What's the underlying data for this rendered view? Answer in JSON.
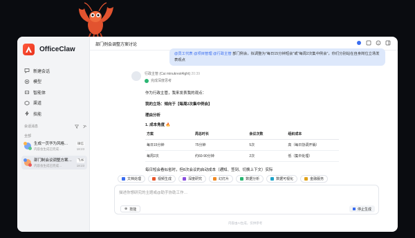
{
  "app": {
    "name": "OfficeClaw"
  },
  "nav": [
    {
      "label": "新建会话",
      "icon": "chat-plus-icon"
    },
    {
      "label": "模型",
      "icon": "model-icon"
    },
    {
      "label": "智能体",
      "icon": "agent-icon"
    },
    {
      "label": "渠道",
      "icon": "channel-icon"
    },
    {
      "label": "技能",
      "icon": "skill-icon"
    }
  ],
  "conversations": {
    "title": "会话消息",
    "group": "全部",
    "items": [
      {
        "name": "生成一页华为风格…",
        "preview": "内容会生成已完成…",
        "tag": "微信",
        "time": "18:23"
      },
      {
        "name": "部门制会议调整方案…",
        "preview": "内容会生成已完成…",
        "tag": "飞书",
        "time": "18:23"
      }
    ]
  },
  "topbar": {
    "title": "部门例会调整方案讨论"
  },
  "user_message": {
    "mentions": [
      "@员工代表",
      "@项目管理",
      "@行政主管"
    ],
    "text": "部门例会，拟调整为\"每日15分钟短会\"或\"每周2次集中例会\"，你们分别站在自身岗位立场发表观点"
  },
  "bot": {
    "name": "行政主管 (Cai minukrest4ight)",
    "time": "20:39",
    "status": "完成深度思考"
  },
  "reply": {
    "intro": "作为行政主管，我来发表我的观点：",
    "stance": "我的立场：倾向于【每周2次集中例会】",
    "reason_title": "理由分析",
    "point1": "1. 成本角度 🔥",
    "table": {
      "headers": [
        "方案",
        "周总时长",
        "会议次数",
        "组织成本"
      ],
      "rows": [
        [
          "每日15分钟",
          "75分钟",
          "5次",
          "高（每日协调开销）"
        ],
        [
          "每周2次",
          "约60-90分钟",
          "2次",
          "低（集中处理）"
        ]
      ]
    },
    "note": "每日短会看似省时，但8次会议的启动成本（通知、签到、切换上下文）实际"
  },
  "chips": [
    {
      "label": "文档处理",
      "color": "#3a6df0"
    },
    {
      "label": "视频生成",
      "color": "#e8562b"
    },
    {
      "label": "深度研究",
      "color": "#8a4fe0"
    },
    {
      "label": "幻灯片",
      "color": "#f08a24"
    },
    {
      "label": "数据分析",
      "color": "#2bb673"
    },
    {
      "label": "数据可视化",
      "color": "#1fa3c9"
    },
    {
      "label": "金融服务",
      "color": "#e0a21a"
    }
  ],
  "input": {
    "placeholder": "描述你想研究的主题或@助手协助工作…",
    "skill_label": "技能",
    "stop_label": "停止生成"
  },
  "footer": {
    "note": "内容由AI生成，仅供参考"
  }
}
